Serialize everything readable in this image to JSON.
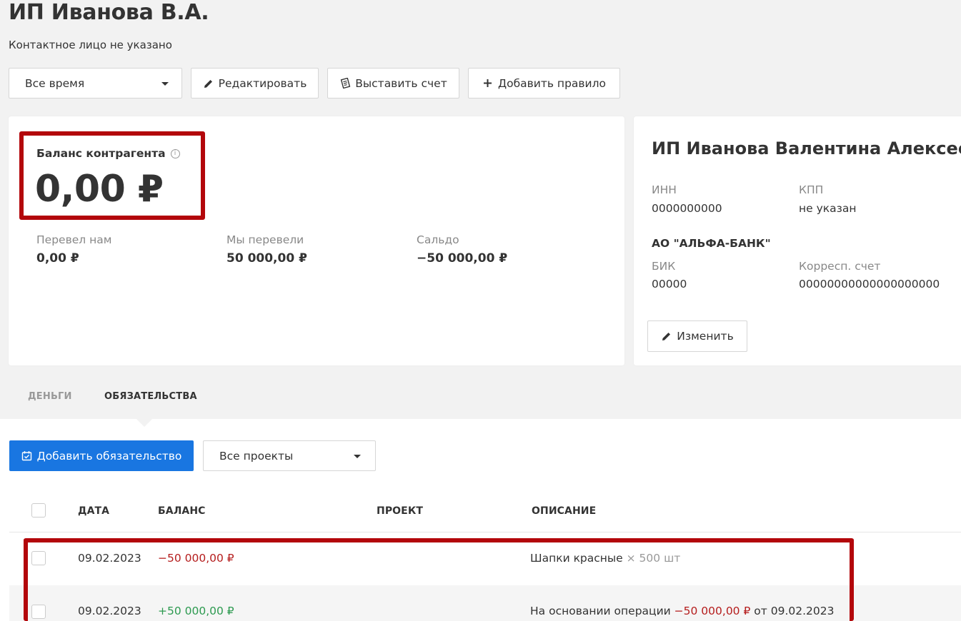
{
  "header": {
    "title": "ИП Иванова В.А.",
    "subtitle": "Контактное лицо не указано"
  },
  "toolbar": {
    "period_value": "Все время",
    "edit_label": "Редактировать",
    "invoice_label": "Выставить счет",
    "add_rule_label": "Добавить правило"
  },
  "balance": {
    "label": "Баланс контрагента",
    "value": "0,00 ₽",
    "stats": [
      {
        "label": "Перевел нам",
        "value": "0,00 ₽"
      },
      {
        "label": "Мы перевели",
        "value": "50 000,00 ₽"
      },
      {
        "label": "Сальдо",
        "value": "−50 000,00 ₽"
      }
    ]
  },
  "details": {
    "full_name": "ИП Иванова Валентина Алексеевна",
    "inn_label": "ИНН",
    "inn_value": "0000000000",
    "kpp_label": "КПП",
    "kpp_value": "не указан",
    "bank_name": "АО \"АЛЬФА-БАНК\"",
    "bik_label": "БИК",
    "bik_value": "00000",
    "corr_label": "Корресп. счет",
    "corr_value": "00000000000000000000",
    "change_label": "Изменить"
  },
  "tabs": [
    {
      "label": "ДЕНЬГИ",
      "active": false
    },
    {
      "label": "ОБЯЗАТЕЛЬСТВА",
      "active": true
    }
  ],
  "actions": {
    "add_obligation_label": "Добавить обязательство",
    "projects_value": "Все проекты"
  },
  "table": {
    "headers": {
      "date": "ДАТА",
      "balance": "БАЛАНС",
      "project": "ПРОЕКТ",
      "description": "ОПИСАНИЕ"
    },
    "rows": [
      {
        "date": "09.02.2023",
        "balance": "−50 000,00 ₽",
        "project": "",
        "description": "Шапки красные",
        "quantity": "× 500 шт"
      },
      {
        "date": "09.02.2023",
        "balance": "+50 000,00 ₽",
        "project": "",
        "description_prefix": "На основании операции",
        "description_amount": "−50 000,00 ₽",
        "description_suffix": "от 09.02.2023"
      }
    ]
  },
  "colors": {
    "primary": "#1976e1",
    "highlight": "#b3070b",
    "negative": "#b51d1d",
    "positive": "#2d9a50"
  }
}
